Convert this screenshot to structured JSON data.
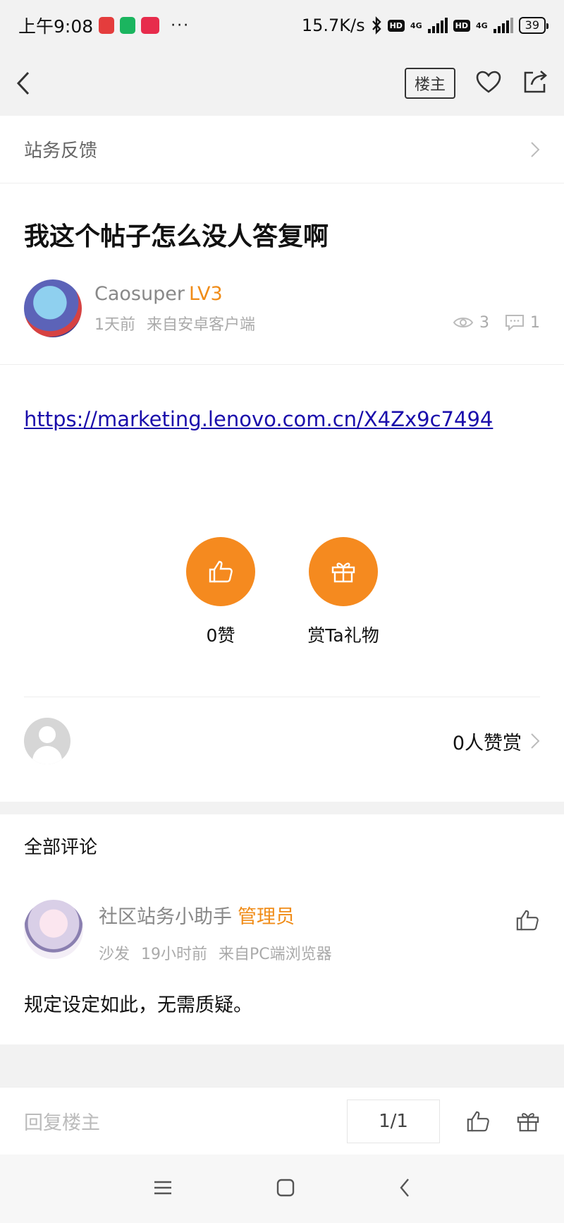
{
  "status_bar": {
    "time": "上午9:08",
    "dots": "···",
    "net_speed": "15.7K/s",
    "hd1": "HD",
    "net1": "4G",
    "hd2": "HD",
    "net2": "4G",
    "battery": "39"
  },
  "nav": {
    "louzhu_label": "楼主",
    "icons": [
      "back-icon",
      "heart-icon",
      "share-icon"
    ]
  },
  "breadcrumb": {
    "label": "站务反馈"
  },
  "post": {
    "title": "我这个帖子怎么没人答复啊",
    "author": "Caosuper",
    "level": "LV3",
    "time": "1天前",
    "source": "来自安卓客户端",
    "views": "3",
    "comments": "1",
    "link": "https://marketing.lenovo.com.cn/X4Zx9c7494"
  },
  "actions": {
    "like_label": "0赞",
    "gift_label": "赏Ta礼物",
    "accent": "#f58a1f"
  },
  "reward": {
    "count_label": "0人赞赏"
  },
  "comments": {
    "title": "全部评论",
    "items": [
      {
        "name": "社区站务小助手",
        "role": "管理员",
        "floor": "沙发",
        "time": "19小时前",
        "source": "来自PC端浏览器",
        "text": "规定设定如此，无需质疑。"
      }
    ]
  },
  "bottom_bar": {
    "reply_placeholder": "回复楼主",
    "pager": "1/1"
  }
}
